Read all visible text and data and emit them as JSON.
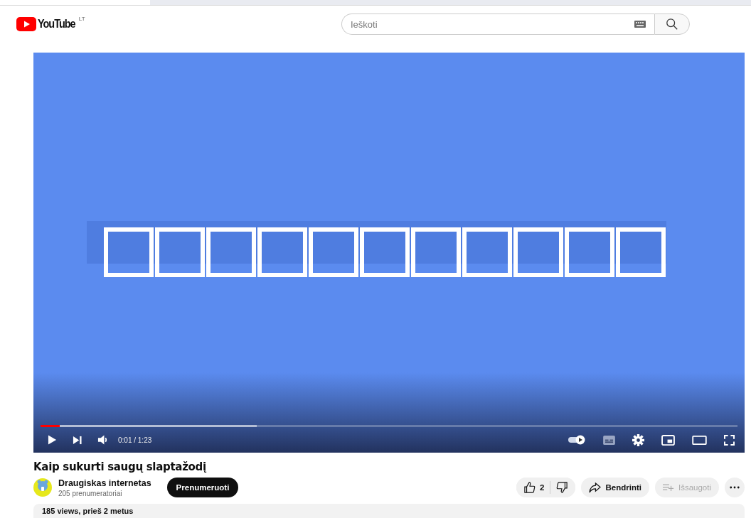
{
  "header": {
    "logo": "YouTube",
    "region": "LT",
    "search": {
      "placeholder": "Ieškoti"
    }
  },
  "player": {
    "progress": {
      "level": 0.028
    },
    "buffer": {
      "level": 0.31
    },
    "time": "0:01 / 1:23",
    "autoplay": true
  },
  "video": {
    "title": "Kaip sukurti saugų slaptažodį",
    "channel": {
      "name": "Draugiskas internetas",
      "subscribers": "205 prenumeratoriai"
    },
    "subscribe": "Prenumeruoti",
    "likes": "2",
    "share": "Bendrinti",
    "save": {
      "label": "Išsaugoti",
      "disabled": true
    }
  },
  "description": {
    "meta": "185 views, prieš 2 metus"
  }
}
